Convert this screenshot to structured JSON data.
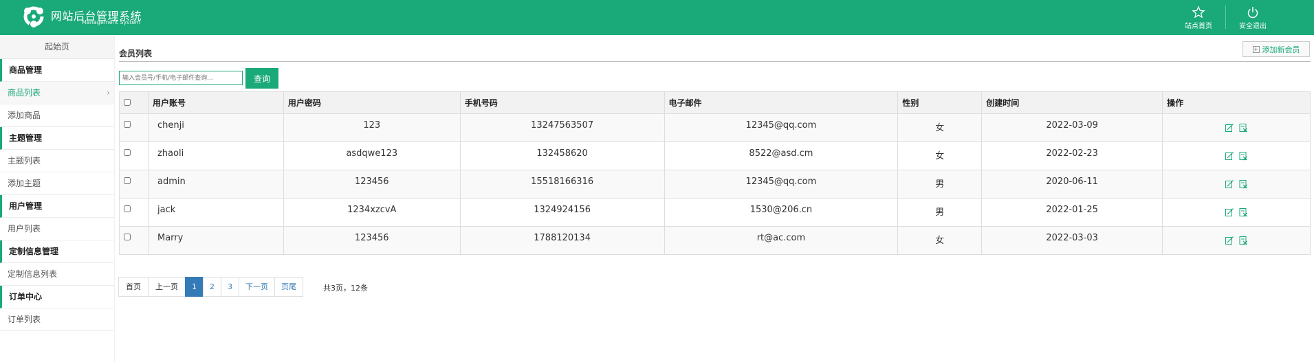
{
  "header": {
    "title": "网站后台管理系统",
    "subtitle": "Management System",
    "logo_icon": "logo-icon",
    "actions": [
      {
        "label": "站点首页",
        "icon": "star-icon"
      },
      {
        "label": "安全退出",
        "icon": "power-icon"
      }
    ],
    "bg_color": "#1aa979"
  },
  "sidebar": {
    "home": "起始页",
    "groups": [
      {
        "title": "商品管理",
        "items": [
          "商品列表",
          "添加商品"
        ]
      },
      {
        "title": "主题管理",
        "items": [
          "主题列表",
          "添加主题"
        ]
      },
      {
        "title": "用户管理",
        "items": [
          "用户列表"
        ]
      },
      {
        "title": "定制信息管理",
        "items": [
          "定制信息列表"
        ]
      },
      {
        "title": "订单中心",
        "items": [
          "订单列表"
        ]
      }
    ],
    "active_item": "商品列表",
    "active_chevron": "chevron-right-icon"
  },
  "main": {
    "heading": "会员列表",
    "add_button": "添加新会员",
    "search": {
      "placeholder": "输入会员号/手机/电子邮件查询...",
      "value": "",
      "button": "查询"
    },
    "table": {
      "columns": [
        "用户账号",
        "用户密码",
        "手机号码",
        "电子邮件",
        "性别",
        "创建时间",
        "操作"
      ],
      "rows": [
        {
          "account": "chenji",
          "password": "123",
          "phone": "13247563507",
          "email": "12345@qq.com",
          "gender": "女",
          "created": "2022-03-09"
        },
        {
          "account": "zhaoli",
          "password": "asdqwe123",
          "phone": "132458620",
          "email": "8522@asd.cm",
          "gender": "女",
          "created": "2022-02-23"
        },
        {
          "account": "admin",
          "password": "123456",
          "phone": "15518166316",
          "email": "12345@qq.com",
          "gender": "男",
          "created": "2020-06-11"
        },
        {
          "account": "jack",
          "password": "1234xzcvA",
          "phone": "1324924156",
          "email": "1530@206.cn",
          "gender": "男",
          "created": "2022-01-25"
        },
        {
          "account": "Marry",
          "password": "123456",
          "phone": "1788120134",
          "email": "rt@ac.com",
          "gender": "女",
          "created": "2022-03-03"
        }
      ],
      "row_actions": [
        "edit-icon",
        "delete-icon"
      ]
    },
    "pagination": {
      "first": "首页",
      "prev": "上一页",
      "pages": [
        "1",
        "2",
        "3"
      ],
      "current": "1",
      "next": "下一页",
      "last": "页尾",
      "summary": "共3页，12条"
    }
  },
  "colors": {
    "accent": "#1aa979",
    "pager_active": "#337ab7"
  }
}
